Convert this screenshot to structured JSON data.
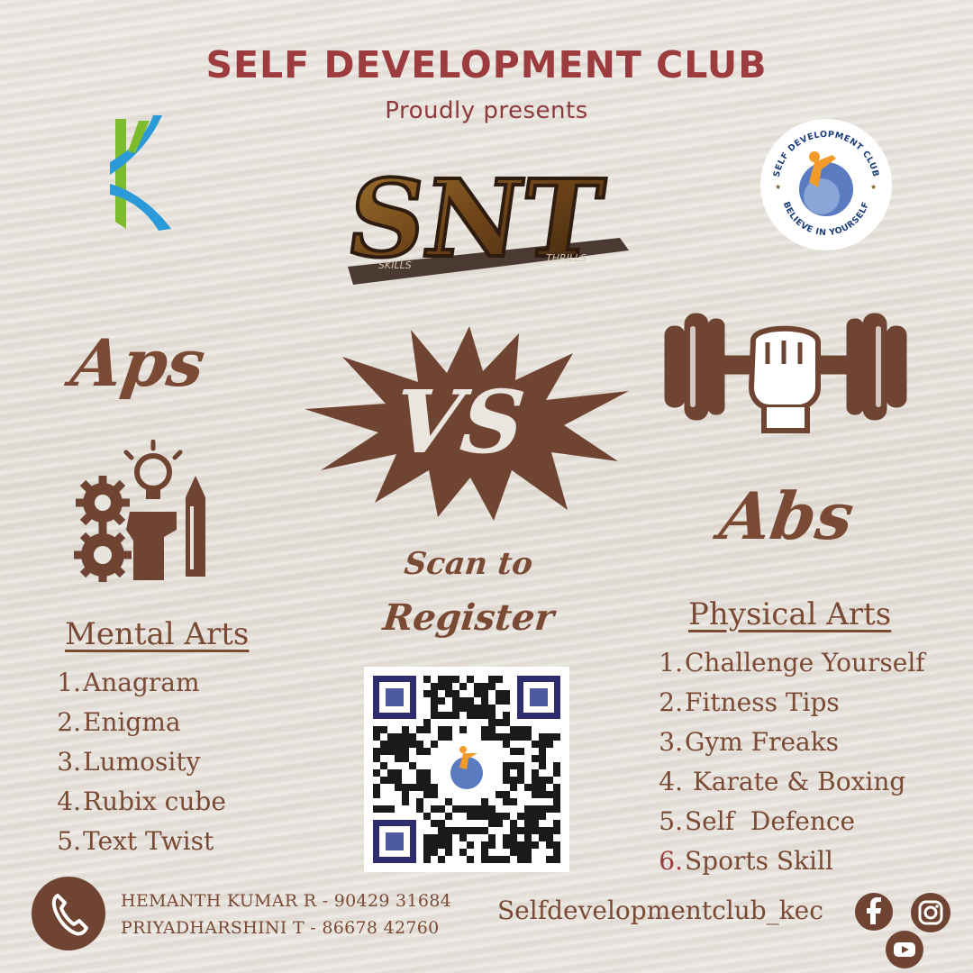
{
  "header": {
    "title": "SELF DEVELOPMENT CLUB",
    "subtitle": "Proudly presents"
  },
  "event_logo": {
    "main": "SNT",
    "left_caption": "SKILLS",
    "right_caption": "THRILLS"
  },
  "club_badge": {
    "top_text": "SELF DEVELOPMENT CLUB",
    "bottom_text": "BELIEVE IN YOURSELF"
  },
  "versus": {
    "left_label": "Aps",
    "center_label": "VS",
    "right_label": "Abs"
  },
  "register": {
    "line1": "Scan to",
    "line2": "Register"
  },
  "mental": {
    "heading": "Mental Arts",
    "items": [
      {
        "num": "1.",
        "label": "Anagram"
      },
      {
        "num": "2.",
        "label": "Enigma"
      },
      {
        "num": "3.",
        "label": "Lumosity"
      },
      {
        "num": "4.",
        "label": "Rubix cube"
      },
      {
        "num": "5.",
        "label": "Text Twist"
      }
    ]
  },
  "physical": {
    "heading": "Physical Arts",
    "items": [
      {
        "num": "1.",
        "label": "Challenge Yourself"
      },
      {
        "num": "2.",
        "label": "Fitness Tips"
      },
      {
        "num": "3.",
        "label": "Gym Freaks"
      },
      {
        "num": "4.",
        "label": " Karate & Boxing"
      },
      {
        "num": "5.",
        "label": "Self  Defence"
      },
      {
        "num": "6.",
        "label": "Sports Skill"
      }
    ]
  },
  "contacts": [
    "HEMANTH  KUMAR R - 90429 31684",
    "PRIYADHARSHINI T - 86678 42760"
  ],
  "social": {
    "handle": "Selfdevelopmentclub_kec",
    "icons": [
      "facebook-icon",
      "instagram-icon",
      "youtube-icon"
    ]
  },
  "colors": {
    "brown": "#7a4a34",
    "title_red": "#9c3c3f",
    "background": "#e8e4de"
  }
}
